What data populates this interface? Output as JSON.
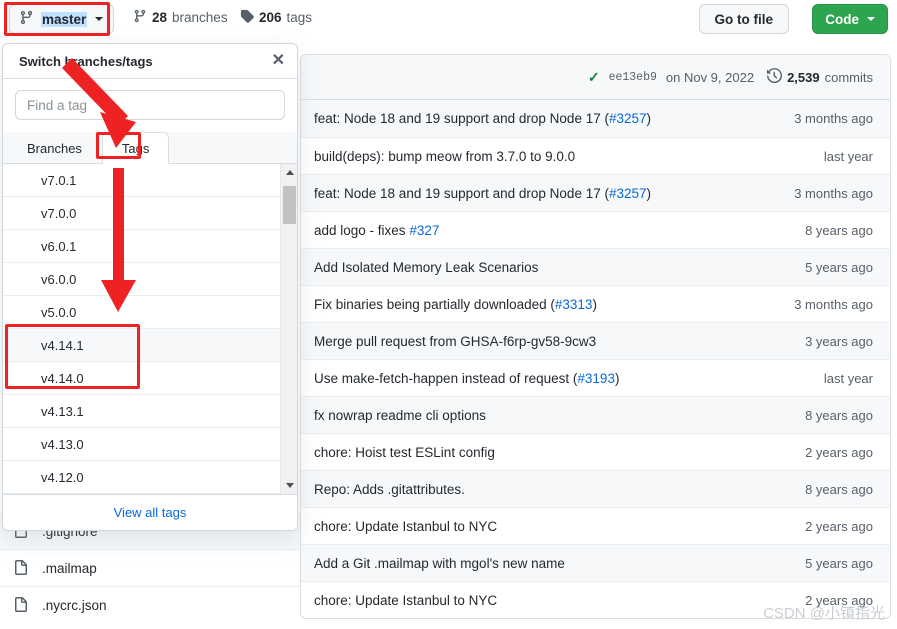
{
  "topbar": {
    "branch_button": {
      "label": "master",
      "icon": "branch-icon"
    },
    "branches_count": "28",
    "branches_label": "branches",
    "tags_count": "206",
    "tags_label": "tags",
    "go_to_file": "Go to file",
    "code_button": "Code"
  },
  "commit_header": {
    "status_icon": "check-icon",
    "sha": "ee13eb9",
    "date": "on Nov 9, 2022",
    "clock_icon": "history-icon",
    "commits_count": "2,539",
    "commits_label": "commits"
  },
  "commits": [
    {
      "message": "feat: Node 18 and 19 support and drop Node 17 (",
      "link": "#3257",
      "suffix": ")",
      "age": "3 months ago"
    },
    {
      "message": "build(deps): bump meow from 3.7.0 to 9.0.0",
      "link": "",
      "suffix": "",
      "age": "last year"
    },
    {
      "message": "feat: Node 18 and 19 support and drop Node 17 (",
      "link": "#3257",
      "suffix": ")",
      "age": "3 months ago"
    },
    {
      "message": "add logo - fixes ",
      "link": "#327",
      "suffix": "",
      "age": "8 years ago"
    },
    {
      "message": "Add Isolated Memory Leak Scenarios",
      "link": "",
      "suffix": "",
      "age": "5 years ago"
    },
    {
      "message": "Fix binaries being partially downloaded (",
      "link": "#3313",
      "suffix": ")",
      "age": "3 months ago"
    },
    {
      "message": "Merge pull request from GHSA-f6rp-gv58-9cw3",
      "link": "",
      "suffix": "",
      "age": "3 years ago"
    },
    {
      "message": "Use make-fetch-happen instead of request (",
      "link": "#3193",
      "suffix": ")",
      "age": "last year"
    },
    {
      "message": "fx nowrap readme cli options",
      "link": "",
      "suffix": "",
      "age": "8 years ago"
    },
    {
      "message": "chore: Hoist test ESLint config",
      "link": "",
      "suffix": "",
      "age": "2 years ago"
    },
    {
      "message": "Repo: Adds .gitattributes.",
      "link": "",
      "suffix": "",
      "age": "8 years ago"
    },
    {
      "message": "chore: Update Istanbul to NYC",
      "link": "",
      "suffix": "",
      "age": "2 years ago"
    },
    {
      "message": "Add a Git .mailmap with mgol's new name",
      "link": "",
      "suffix": "",
      "age": "5 years ago"
    },
    {
      "message": "chore: Update Istanbul to NYC",
      "link": "",
      "suffix": "",
      "age": "2 years ago"
    }
  ],
  "files": [
    {
      "name": ".gitignore",
      "icon": "file-icon"
    },
    {
      "name": ".mailmap",
      "icon": "file-icon"
    },
    {
      "name": ".nycrc.json",
      "icon": "file-icon"
    }
  ],
  "dropdown": {
    "title": "Switch branches/tags",
    "close_icon": "close-icon",
    "search_placeholder": "Find a tag",
    "search_value": "",
    "tabs": [
      {
        "label": "Branches",
        "active": false
      },
      {
        "label": "Tags",
        "active": true
      }
    ],
    "tags": [
      {
        "name": "v7.0.1",
        "highlighted": false
      },
      {
        "name": "v7.0.0",
        "highlighted": false
      },
      {
        "name": "v6.0.1",
        "highlighted": false
      },
      {
        "name": "v6.0.0",
        "highlighted": false
      },
      {
        "name": "v5.0.0",
        "highlighted": false
      },
      {
        "name": "v4.14.1",
        "highlighted": true
      },
      {
        "name": "v4.14.0",
        "highlighted": false
      },
      {
        "name": "v4.13.1",
        "highlighted": false
      },
      {
        "name": "v4.13.0",
        "highlighted": false
      },
      {
        "name": "v4.12.0",
        "highlighted": false
      }
    ],
    "footer_link": "View all tags"
  },
  "annotations": {
    "accent_color": "#ee2222",
    "boxes": [
      "master-branch-button",
      "tags-tab",
      "tag-v4.14.x-rows"
    ],
    "arrows": [
      "arrow-to-tags-tab",
      "arrow-to-v4.14.x"
    ]
  },
  "watermark": "CSDN @小镇指光",
  "colors": {
    "brand_green": "#2da44e",
    "link_blue": "#0969da",
    "annotation_red": "#ee2222",
    "border_gray": "#d0d7de",
    "muted_text": "#57606a"
  }
}
